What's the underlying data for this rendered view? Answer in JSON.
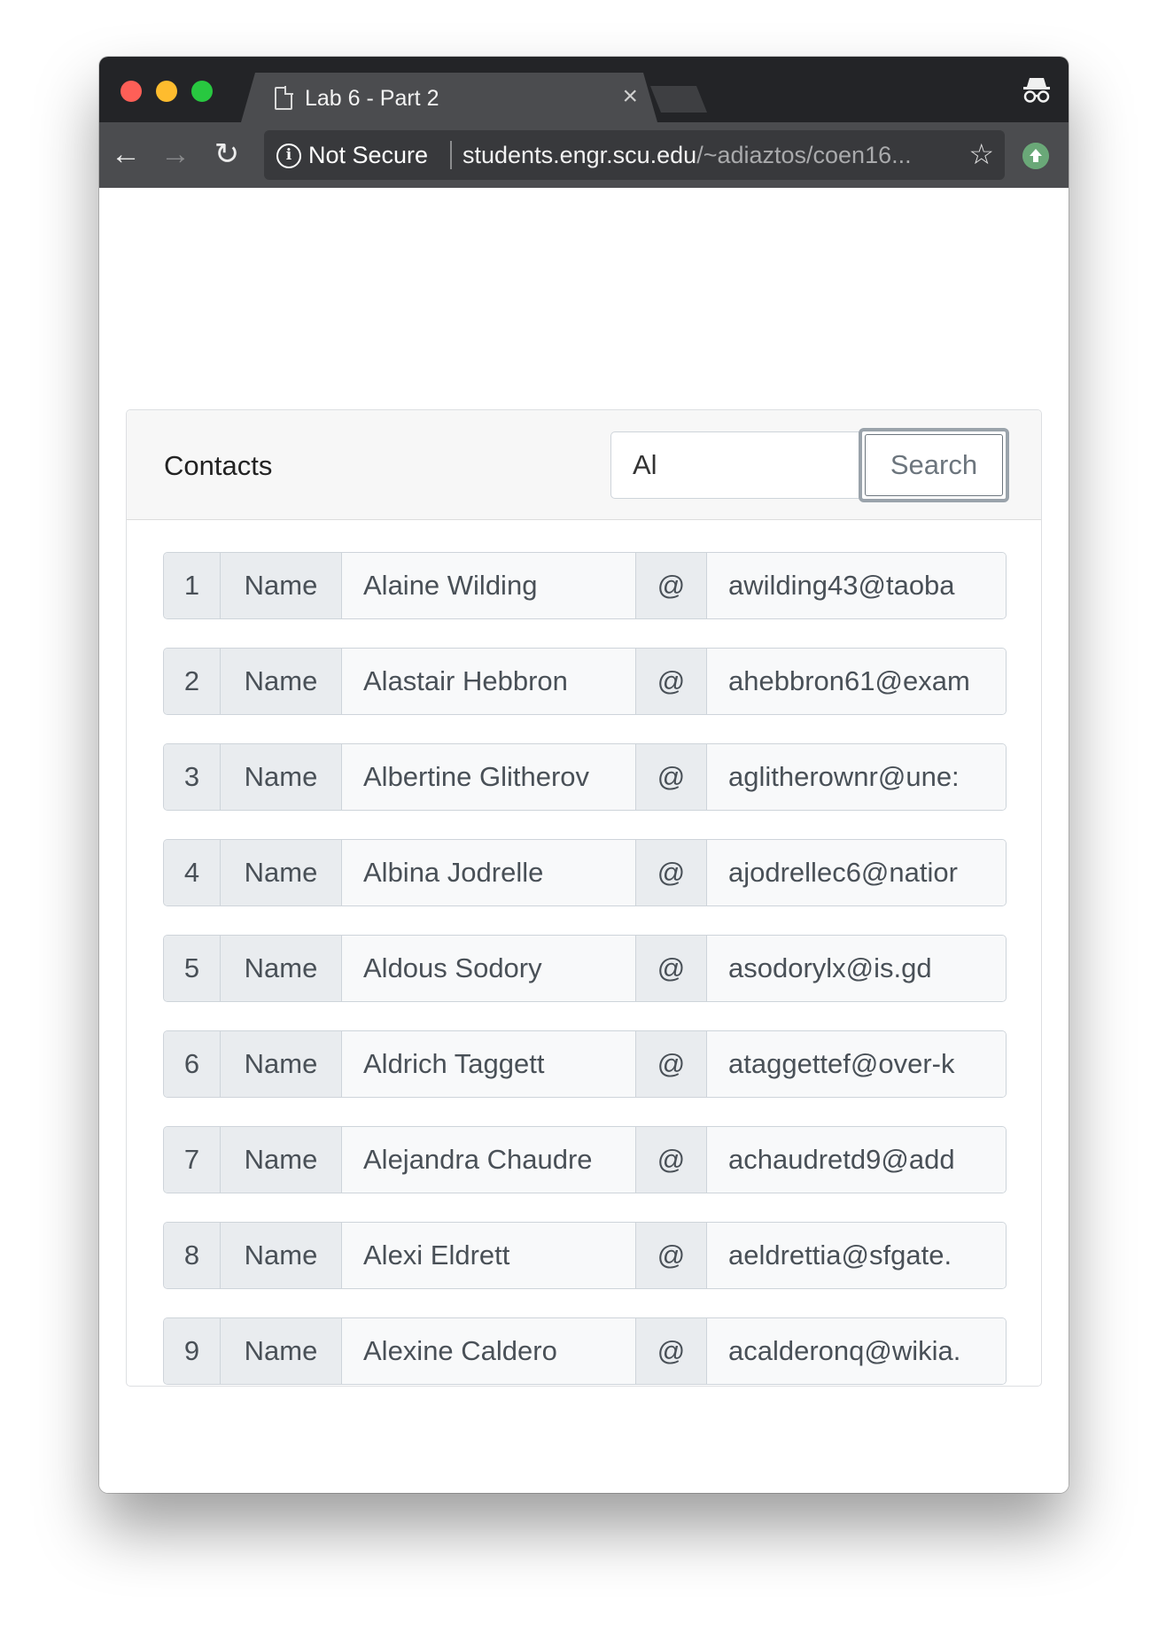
{
  "browser": {
    "tab_title": "Lab 6 - Part 2",
    "tab_close": "×",
    "security_label": "Not Secure",
    "url_host": "students.engr.scu.edu",
    "url_path": "/~adiaztos/coen16...",
    "icons": [
      "doc-icon",
      "close-icon",
      "incognito-icon",
      "back-arrow-icon",
      "forward-arrow-icon",
      "reload-icon",
      "info-icon",
      "star-icon",
      "extension-icon"
    ]
  },
  "card": {
    "title": "Contacts",
    "search": {
      "value": "Al",
      "button_label": "Search"
    }
  },
  "contacts": [
    {
      "index": "1",
      "name_label": "Name",
      "name": "Alaine Wilding",
      "at": "@",
      "email": "awilding43@taoba"
    },
    {
      "index": "2",
      "name_label": "Name",
      "name": "Alastair Hebbron",
      "at": "@",
      "email": "ahebbron61@exam"
    },
    {
      "index": "3",
      "name_label": "Name",
      "name": "Albertine Glitherov",
      "at": "@",
      "email": "aglitherownr@une:"
    },
    {
      "index": "4",
      "name_label": "Name",
      "name": "Albina Jodrelle",
      "at": "@",
      "email": "ajodrellec6@natior"
    },
    {
      "index": "5",
      "name_label": "Name",
      "name": "Aldous Sodory",
      "at": "@",
      "email": "asodorylx@is.gd"
    },
    {
      "index": "6",
      "name_label": "Name",
      "name": "Aldrich Taggett",
      "at": "@",
      "email": "ataggettef@over-k"
    },
    {
      "index": "7",
      "name_label": "Name",
      "name": "Alejandra Chaudre",
      "at": "@",
      "email": "achaudretd9@add"
    },
    {
      "index": "8",
      "name_label": "Name",
      "name": "Alexi Eldrett",
      "at": "@",
      "email": "aeldrettia@sfgate."
    },
    {
      "index": "9",
      "name_label": "Name",
      "name": "Alexine Caldero",
      "at": "@",
      "email": "acalderonq@wikia."
    }
  ]
}
